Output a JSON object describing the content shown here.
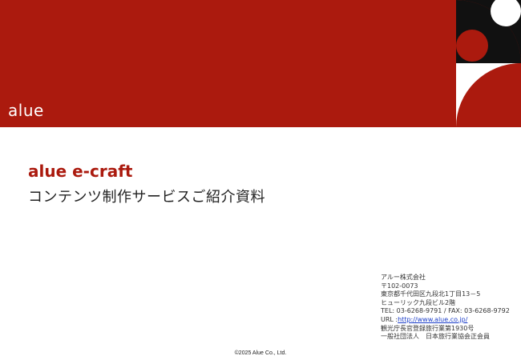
{
  "header": {
    "logo": "alue"
  },
  "title": {
    "main": "alue e-craft",
    "sub": "コンテンツ制作サービスご紹介資料"
  },
  "company": {
    "name": "アルー株式会社",
    "postal": "〒102-0073",
    "address1": "東京都千代田区九段北1丁目13－5",
    "address2": "ヒューリック九段ビル2階",
    "phone": "TEL: 03-6268-9791 / FAX: 03-6268-9792",
    "url_label": "URL :",
    "url": "http://www.alue.co.jp/",
    "registration": "観光庁長官登録旅行業第1930号",
    "association": "一般社団法人　日本旅行業協会正会員"
  },
  "footer": {
    "copyright": "©2025 Alue Co., Ltd."
  },
  "colors": {
    "brand": "#ab1a0e",
    "dark": "#111111",
    "link": "#1a3cc8"
  }
}
